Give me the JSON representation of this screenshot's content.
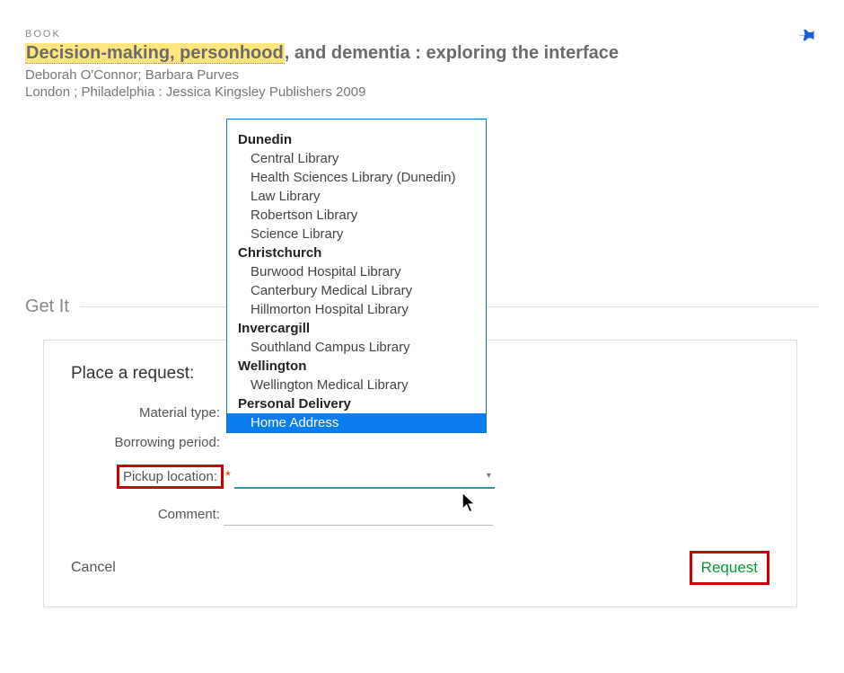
{
  "header": {
    "type_label": "BOOK",
    "title_highlight": "Decision-making, personhood",
    "title_rest": ", and dementia : exploring the interface",
    "authors": "Deborah O'Connor; Barbara Purves",
    "imprint": "London ; Philadelphia : Jessica Kingsley Publishers 2009"
  },
  "section": {
    "get_it": "Get It"
  },
  "form": {
    "title": "Place a request:",
    "labels": {
      "material_type": "Material type:",
      "borrowing_period": "Borrowing period:",
      "pickup_location": "Pickup location:",
      "comment": "Comment:"
    },
    "values": {
      "material_type": "",
      "borrowing_period": "",
      "pickup_location": "",
      "comment": ""
    },
    "actions": {
      "cancel": "Cancel",
      "request": "Request"
    }
  },
  "dropdown": {
    "groups": [
      {
        "name": "Dunedin",
        "items": [
          "Central Library",
          "Health Sciences Library (Dunedin)",
          "Law Library",
          "Robertson Library",
          "Science Library"
        ]
      },
      {
        "name": "Christchurch",
        "items": [
          "Burwood Hospital Library",
          "Canterbury Medical Library",
          "Hillmorton Hospital Library"
        ]
      },
      {
        "name": "Invercargill",
        "items": [
          "Southland Campus Library"
        ]
      },
      {
        "name": "Wellington",
        "items": [
          "Wellington Medical Library"
        ]
      },
      {
        "name": "Personal Delivery",
        "items": [
          "Home Address"
        ]
      }
    ],
    "selected": "Home Address"
  }
}
